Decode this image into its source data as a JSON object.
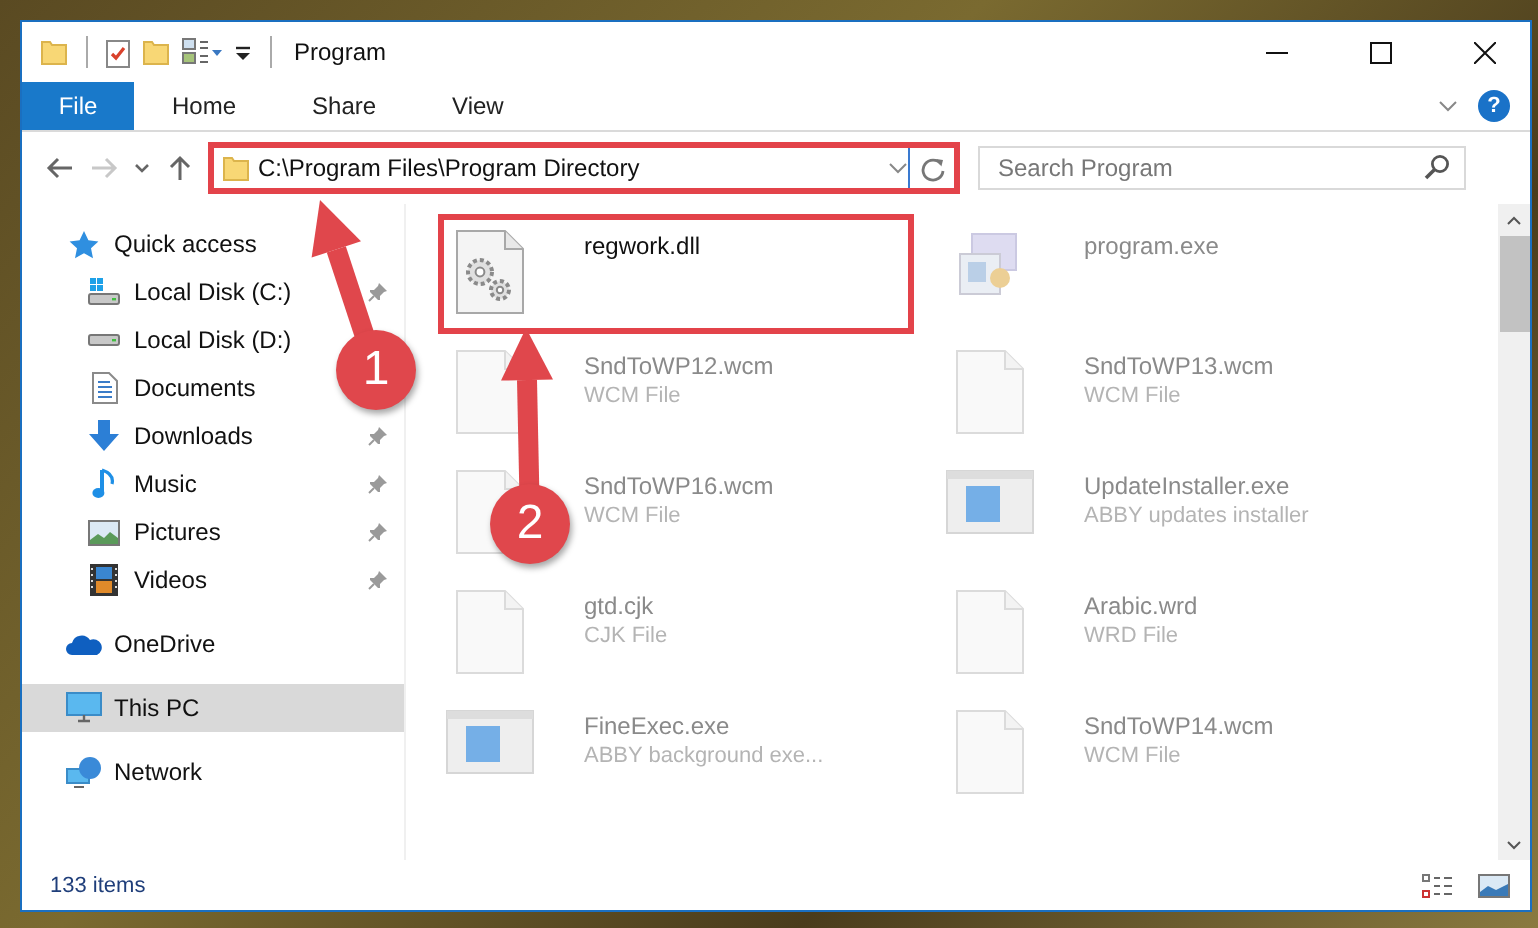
{
  "window": {
    "title": "Program"
  },
  "ribbon": {
    "tabs": [
      {
        "label": "File",
        "kind": "file"
      },
      {
        "label": "Home",
        "kind": "tab"
      },
      {
        "label": "Share",
        "kind": "tab"
      },
      {
        "label": "View",
        "kind": "tab"
      }
    ],
    "help_label": "?"
  },
  "nav_buttons": [
    {
      "kind": "back",
      "disabled": false
    },
    {
      "kind": "forward",
      "disabled": true
    },
    {
      "kind": "recent",
      "disabled": false
    },
    {
      "kind": "up",
      "disabled": false
    }
  ],
  "address": {
    "path": "C:\\Program Files\\Program Directory",
    "highlighted": true
  },
  "search": {
    "placeholder": "Search Program"
  },
  "sidebar": {
    "items": [
      {
        "label": "Quick access",
        "selected": false,
        "children": [
          {
            "label": "Local Disk (C:)",
            "pinned": true,
            "selected": false
          },
          {
            "label": "Local Disk (D:)",
            "selected": false
          },
          {
            "label": "Documents",
            "selected": false
          },
          {
            "label": "Downloads",
            "pinned": true,
            "selected": false
          },
          {
            "label": "Music",
            "pinned": true,
            "selected": false
          },
          {
            "label": "Pictures",
            "pinned": true,
            "selected": false
          },
          {
            "label": "Videos",
            "pinned": true,
            "selected": false
          }
        ]
      },
      {
        "label": "OneDrive",
        "selected": false
      },
      {
        "label": "This PC",
        "selected": true
      },
      {
        "label": "Network",
        "selected": false
      }
    ]
  },
  "files": [
    {
      "name": "regwork.dll",
      "kind": "gear-file",
      "highlighted": true,
      "blurred": false
    },
    {
      "name": "program.exe",
      "kind": "installer",
      "highlighted": false,
      "blurred": true
    },
    {
      "name": "SndToWP12.wcm",
      "type": "WCM File",
      "kind": "blank",
      "highlighted": false,
      "blurred": true
    },
    {
      "name": "SndToWP13.wcm",
      "type": "WCM File",
      "kind": "blank",
      "highlighted": false,
      "blurred": true
    },
    {
      "name": "SndToWP16.wcm",
      "type": "WCM File",
      "kind": "blank",
      "highlighted": false,
      "blurred": true
    },
    {
      "name": "UpdateInstaller.exe",
      "type": "ABBY updates installer",
      "kind": "app-window",
      "highlighted": false,
      "blurred": true
    },
    {
      "name": "gtd.cjk",
      "type": "CJK File",
      "kind": "blank",
      "highlighted": false,
      "blurred": true
    },
    {
      "name": "Arabic.wrd",
      "type": "WRD File",
      "kind": "blank",
      "highlighted": false,
      "blurred": true
    },
    {
      "name": "FineExec.exe",
      "type": "ABBY background exe...",
      "kind": "app-window",
      "highlighted": false,
      "blurred": true
    },
    {
      "name": "SndToWP14.wcm",
      "type": "WCM File",
      "kind": "blank",
      "highlighted": false,
      "blurred": true
    }
  ],
  "status_bar": {
    "item_count": "133 items"
  },
  "callouts": [
    {
      "number": "1"
    },
    {
      "number": "2"
    }
  ]
}
